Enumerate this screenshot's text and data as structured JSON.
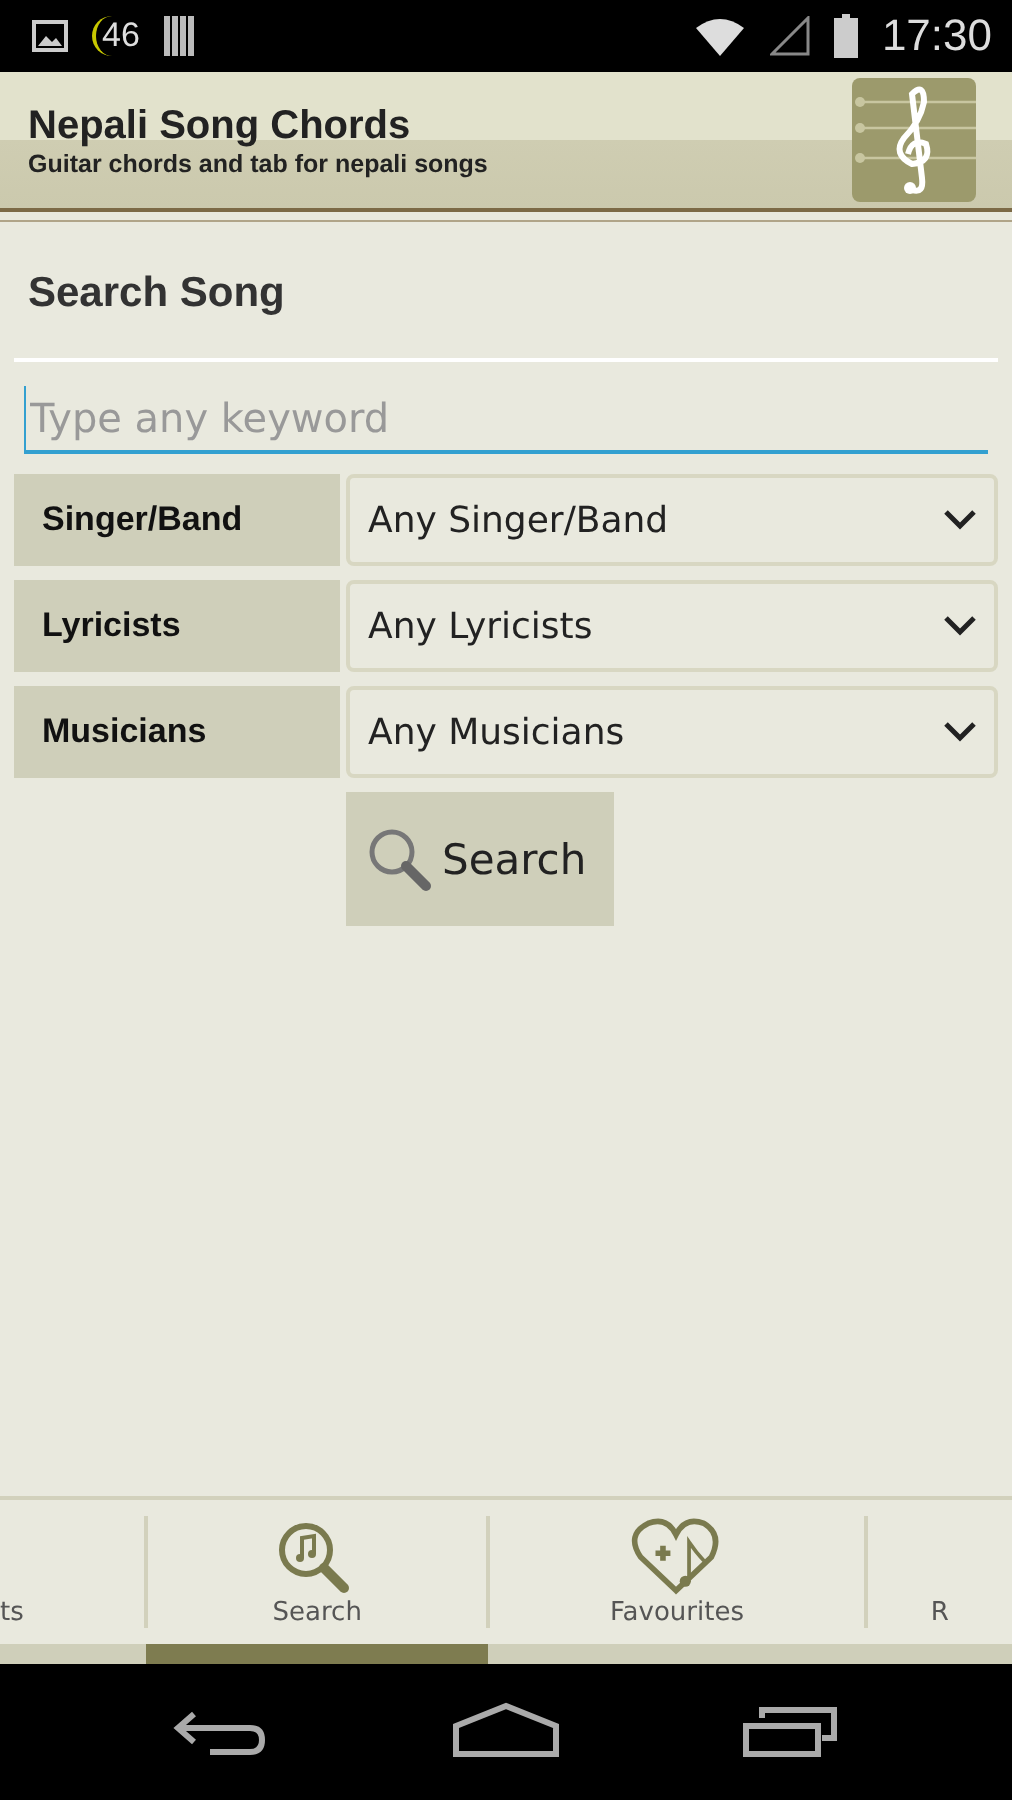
{
  "status_bar": {
    "network": "46",
    "time": "17:30"
  },
  "header": {
    "title": "Nepali Song Chords",
    "subtitle": "Guitar chords and tab for nepali songs"
  },
  "search": {
    "heading": "Search Song",
    "placeholder": "Type any keyword",
    "filters": [
      {
        "label": "Singer/Band",
        "value": "Any Singer/Band"
      },
      {
        "label": "Lyricists",
        "value": "Any Lyricists"
      },
      {
        "label": "Musicians",
        "value": "Any Musicians"
      }
    ],
    "button": "Search"
  },
  "tabs": [
    {
      "label": "ts",
      "kind": "cut",
      "selected": false
    },
    {
      "label": "Search",
      "kind": "search",
      "selected": true
    },
    {
      "label": "Favourites",
      "kind": "favourites",
      "selected": false
    },
    {
      "label": "R",
      "kind": "cut",
      "selected": false
    }
  ]
}
